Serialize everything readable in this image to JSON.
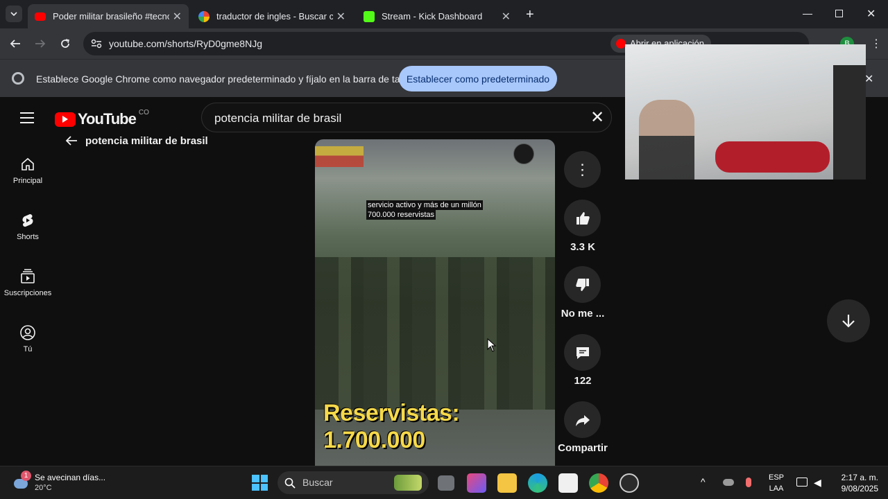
{
  "browser": {
    "tabs": [
      {
        "title": "Poder militar brasileño #tecnolo",
        "active": true,
        "favicon": "youtube-favicon",
        "color": "#ff0000"
      },
      {
        "title": "traductor de ingles - Buscar con",
        "active": false,
        "favicon": "google-favicon",
        "color": "#4285f4"
      },
      {
        "title": "Stream - Kick Dashboard",
        "active": false,
        "favicon": "kick-favicon",
        "color": "#53fc18"
      }
    ],
    "url": "youtube.com/shorts/RyD0gme8NJg",
    "open_in_app": "Abrir en aplicación",
    "profile_initial": "B"
  },
  "infobar": {
    "text": "Establece Google Chrome como navegador predeterminado y fíjalo en la barra de tareas",
    "button": "Establecer como predeterminado"
  },
  "youtube": {
    "logo": "YouTube",
    "region": "CO",
    "search_value": "potencia militar de brasil",
    "back_title": "potencia militar de brasil",
    "sidebar": [
      {
        "label": "Principal",
        "icon": "home-icon"
      },
      {
        "label": "Shorts",
        "icon": "shorts-icon"
      },
      {
        "label": "Suscripciones",
        "icon": "subscriptions-icon"
      },
      {
        "label": "Tú",
        "icon": "you-icon"
      }
    ],
    "video": {
      "caption_line1": "servicio activo y más de un millón",
      "caption_line2": "700.000 reservistas",
      "overlay_text": "Reservistas: 1.700.000"
    },
    "actions": {
      "likes": "3.3 K",
      "dislike": "No me ...",
      "comments": "122",
      "share": "Compartir"
    }
  },
  "taskbar": {
    "weather_title": "Se avecinan días...",
    "weather_temp": "20°C",
    "weather_badge": "1",
    "search_placeholder": "Buscar",
    "lang_top": "ESP",
    "lang_bottom": "LAA",
    "time": "2:17 a. m.",
    "date": "9/08/2025"
  }
}
